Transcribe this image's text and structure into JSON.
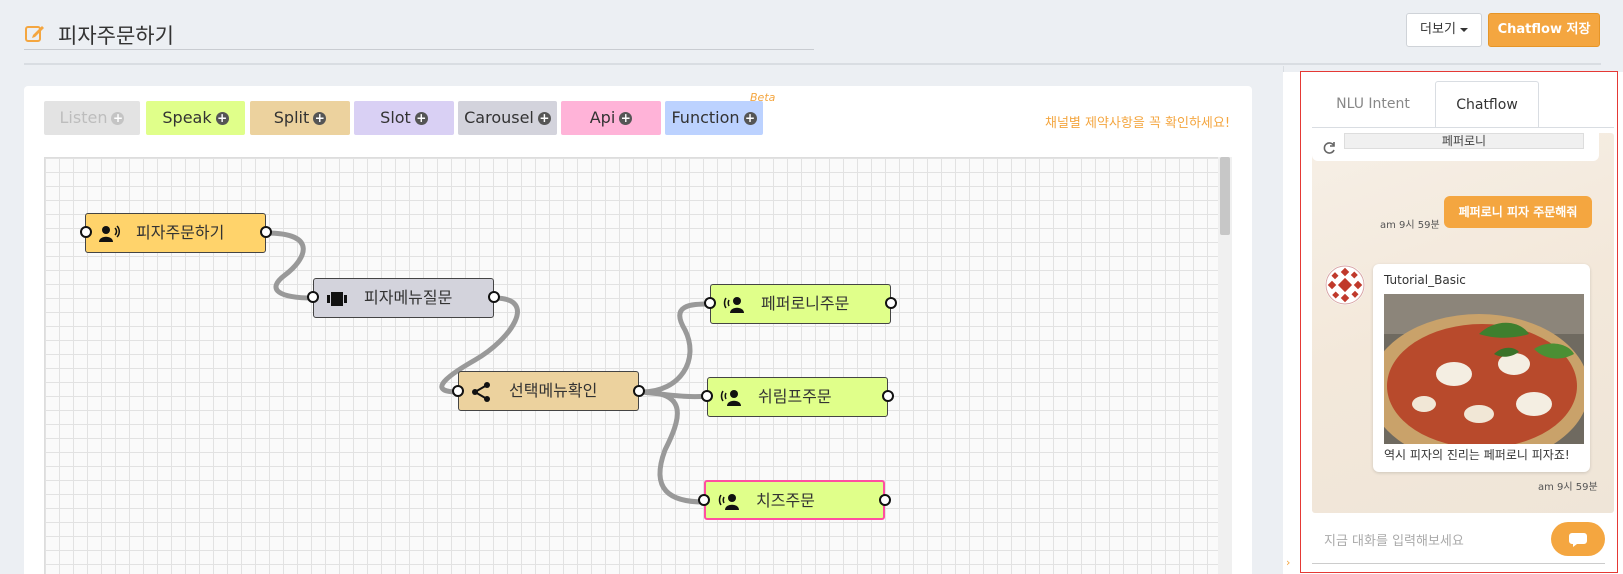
{
  "header": {
    "title": "피자주문하기",
    "more_label": "더보기",
    "save_label": "Chatflow 저장"
  },
  "palette": {
    "items": [
      {
        "label": "Listen"
      },
      {
        "label": "Speak"
      },
      {
        "label": "Split"
      },
      {
        "label": "Slot"
      },
      {
        "label": "Carousel"
      },
      {
        "label": "Api"
      },
      {
        "label": "Function"
      }
    ],
    "beta_label": "Beta",
    "notice": "채널별 제약사항을 꼭 확인하세요!"
  },
  "flow": {
    "nodes": [
      {
        "label": "피자주문하기",
        "type": "listen"
      },
      {
        "label": "피자메뉴질문",
        "type": "slot"
      },
      {
        "label": "선택메뉴확인",
        "type": "split"
      },
      {
        "label": "페퍼로니주문",
        "type": "speak"
      },
      {
        "label": "쉬림프주문",
        "type": "speak"
      },
      {
        "label": "치즈주문",
        "type": "speak"
      }
    ]
  },
  "side_panel": {
    "tabs": [
      {
        "label": "NLU Intent"
      },
      {
        "label": "Chatflow"
      }
    ],
    "active_tab": "Chatflow"
  },
  "chat": {
    "previous_option": "페퍼로니",
    "user_message": "페퍼로니 피자 주문해줘",
    "user_time": "am 9시 59분",
    "bot_name": "Tutorial_Basic",
    "bot_message": "역시 피자의 진리는 페퍼로니 피자죠!",
    "bot_time": "am 9시 59분",
    "input_placeholder": "지금 대화를 입력해보세요"
  },
  "colors": {
    "accent": "#f4a640",
    "listen": "#ffd36b",
    "speak": "#e0ff8a",
    "split": "#ecd29e",
    "slot": "#d9d0f4",
    "carousel": "#d3d3dc",
    "api": "#ffb3d8",
    "function": "#bcd2ff",
    "selected_border": "#ff4fa0"
  }
}
